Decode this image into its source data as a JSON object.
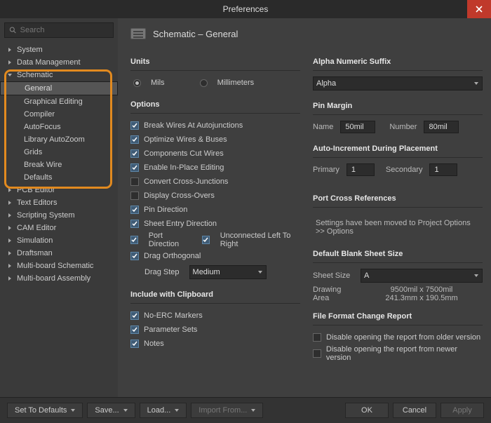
{
  "window": {
    "title": "Preferences",
    "search_placeholder": "Search"
  },
  "tree": {
    "items": [
      "System",
      "Data Management",
      "Schematic",
      "General",
      "Graphical Editing",
      "Compiler",
      "AutoFocus",
      "Library AutoZoom",
      "Grids",
      "Break Wire",
      "Defaults",
      "PCB Editor",
      "Text Editors",
      "Scripting System",
      "CAM Editor",
      "Simulation",
      "Draftsman",
      "Multi-board Schematic",
      "Multi-board Assembly"
    ]
  },
  "header": {
    "title": "Schematic – General"
  },
  "units": {
    "title": "Units",
    "mils": "Mils",
    "millimeters": "Millimeters"
  },
  "options": {
    "title": "Options",
    "items": [
      "Break Wires At Autojunctions",
      "Optimize Wires & Buses",
      "Components Cut Wires",
      "Enable In-Place Editing",
      "Convert Cross-Junctions",
      "Display Cross-Overs",
      "Pin Direction",
      "Sheet Entry Direction",
      "Port Direction",
      "Unconnected Left To Right",
      "Drag Orthogonal"
    ],
    "drag_step_label": "Drag Step",
    "drag_step_value": "Medium"
  },
  "clipboard": {
    "title": "Include with Clipboard",
    "items": [
      "No-ERC Markers",
      "Parameter Sets",
      "Notes"
    ]
  },
  "alpha": {
    "title": "Alpha Numeric Suffix",
    "value": "Alpha"
  },
  "pinmargin": {
    "title": "Pin Margin",
    "name_label": "Name",
    "name_val": "50mil",
    "number_label": "Number",
    "number_val": "80mil"
  },
  "autoinc": {
    "title": "Auto-Increment During Placement",
    "primary_label": "Primary",
    "primary_val": "1",
    "secondary_label": "Secondary",
    "secondary_val": "1"
  },
  "portcross": {
    "title": "Port Cross References",
    "note": "Settings have been moved to Project Options >> Options"
  },
  "sheet": {
    "title": "Default Blank Sheet Size",
    "size_label": "Sheet Size",
    "size_val": "A",
    "area_label": "Drawing Area",
    "area_px": "9500mil x 7500mil",
    "area_mm": "241.3mm x 190.5mm"
  },
  "fileformat": {
    "title": "File Format Change Report",
    "older": "Disable opening the report from older version",
    "newer": "Disable opening the report from newer version"
  },
  "buttons": {
    "defaults": "Set To Defaults",
    "save": "Save...",
    "load": "Load...",
    "import": "Import From...",
    "ok": "OK",
    "cancel": "Cancel",
    "apply": "Apply"
  }
}
